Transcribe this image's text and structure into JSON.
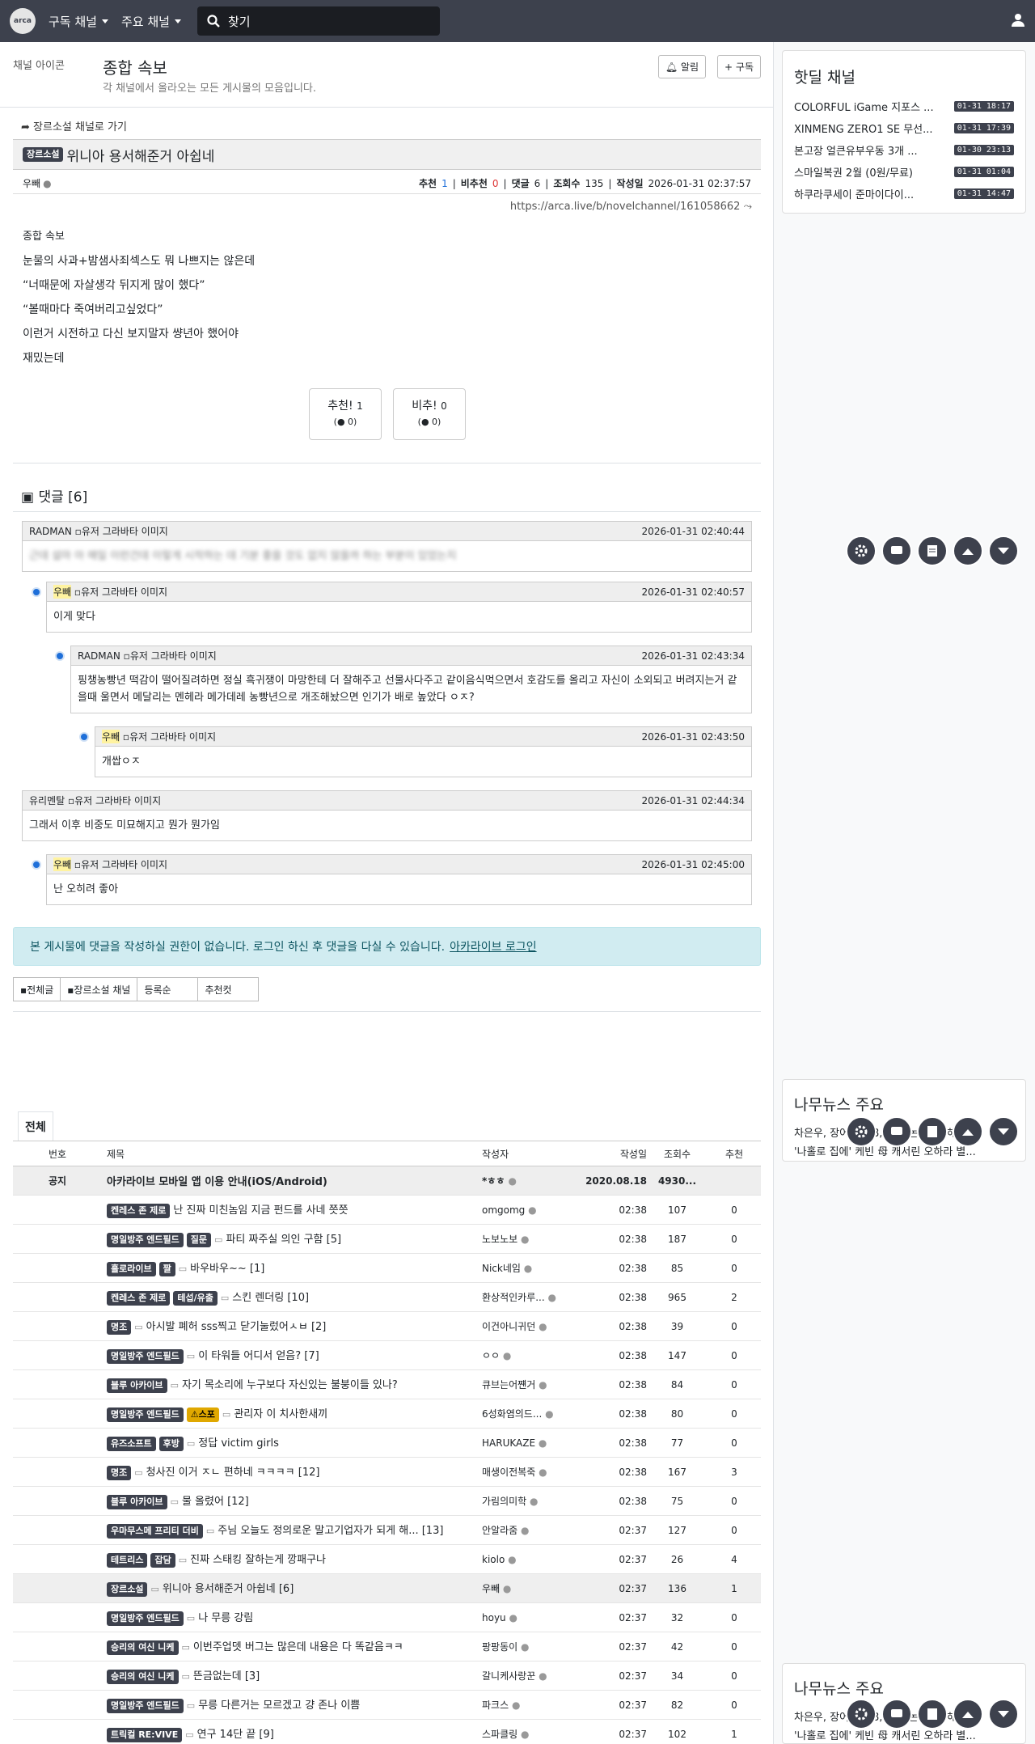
{
  "nav": {
    "logo": "arca",
    "subscribed": "구독 채널",
    "main_channels": "주요 채널",
    "search_placeholder": "찾기"
  },
  "channel": {
    "img_alt": "채널 아이콘",
    "title": "종합 속보",
    "desc": "각 채널에서 올라오는 모든 게시물의 모음입니다.",
    "alarm": "알림",
    "subscribe": "구독"
  },
  "post": {
    "goto": "장르소설 채널로 가기",
    "category": "장르소설",
    "title": "위니아 용서해준거 아쉽네",
    "author": "우빼",
    "stats": {
      "rec_label": "추천",
      "rec": "1",
      "nrec_label": "비추천",
      "nrec": "0",
      "cmt_label": "댓글",
      "cmt": "6",
      "views_label": "조회수",
      "views": "135",
      "date_label": "작성일",
      "date": "2026-01-31 02:37:57"
    },
    "url": "https://arca.live/b/novelchannel/161058662",
    "img_alt": "종합 속보",
    "lines": [
      "눈물의 사과+밤샘사죄섹스도 뭐 나쁘지는 않은데",
      "“너때문에 자살생각 뒤지게 많이 했다”",
      "“볼때마다 죽여버리고싶었다”",
      "이런거 시전하고 다신 보지말자 썅년아 했어야",
      "재밌는데"
    ],
    "vote_up": "추천!",
    "vote_up_count": "1",
    "vote_up_sub": "0",
    "vote_down": "비추!",
    "vote_down_count": "0",
    "vote_down_sub": "0"
  },
  "comments": {
    "header": "댓글 [6]",
    "avatar_alt": "유저 그라바타 이미지",
    "items": [
      {
        "author": "RADMAN",
        "time": "2026-01-31 02:40:44",
        "text": "근데 설마 아 매일 이런건데 이렇게 시작하는 데 기분 좋을 것도 없지 않을까 하는 부분이 있었는지"
      },
      {
        "author": "우빼",
        "time": "2026-01-31 02:40:57",
        "text": "이게 맞다"
      },
      {
        "author": "RADMAN",
        "time": "2026-01-31 02:43:34",
        "text": "핑챙농빵년 떡감이 떨어질려하면 정실 흑귀쟁이 마망한테 더 잘해주고 선물사다주고 같이음식먹으면서 호감도를 올리고 자신이 소외되고 버려지는거 같을때 울면서 메달리는 멘헤라 메가데레 농빵년으로 개조해놨으면 인기가 배로 높았다 ㅇㅈ?"
      },
      {
        "author": "우빼",
        "time": "2026-01-31 02:43:50",
        "text": "개쌉ㅇㅈ"
      },
      {
        "author": "유리멘탈",
        "time": "2026-01-31 02:44:34",
        "text": "그래서 이후 비중도 미묘해지고 뭔가 뭔가임"
      },
      {
        "author": "우빼",
        "time": "2026-01-31 02:45:00",
        "text": "난 오히려 좋아"
      }
    ]
  },
  "notice": {
    "text": "본 게시물에 댓글을 작성하실 권한이 없습니다. 로그인 하신 후 댓글을 다실 수 있습니다.",
    "link": "아카라이브 로그인"
  },
  "filters": [
    "전체글",
    "장르소설 채널",
    "등록순",
    "추천컷"
  ],
  "table": {
    "tab": "전체",
    "headers": [
      "번호",
      "제목",
      "작성자",
      "작성일",
      "조회수",
      "추천"
    ],
    "rows": [
      {
        "num": "공지",
        "badges": [],
        "title": "아카라이브 모바일 앱 이용 안내(iOS/Android)",
        "author": "*ㅎㅎ",
        "date": "2020.08.18",
        "views": "4930...",
        "rec": ""
      },
      {
        "num": "",
        "badges": [
          "켄레스 존 제로"
        ],
        "title": "난 진짜 미친놈임 지금 펀드를 사네 쯧쯧",
        "author": "omgomg",
        "date": "02:38",
        "views": "107",
        "rec": "0"
      },
      {
        "num": "",
        "badges": [
          "명일방주 엔드필드",
          "질문"
        ],
        "title": "파티 짜주실 의인 구함 [5]",
        "author": "노보노보",
        "date": "02:38",
        "views": "187",
        "rec": "0"
      },
      {
        "num": "",
        "badges": [
          "홀로라이브",
          "짤"
        ],
        "title": "바우바우~~ [1]",
        "author": "Nick네임",
        "date": "02:38",
        "views": "85",
        "rec": "0"
      },
      {
        "num": "",
        "badges": [
          "켄레스 존 제로",
          "테섭/유출"
        ],
        "title": "스킨 렌더링 [10]",
        "author": "환상적인카루...",
        "date": "02:38",
        "views": "965",
        "rec": "2"
      },
      {
        "num": "",
        "badges": [
          "명조"
        ],
        "title": "아시발 폐허 sss찍고 닫기눌렀어ㅅㅂ [2]",
        "author": "이건아니귀던",
        "date": "02:38",
        "views": "39",
        "rec": "0"
      },
      {
        "num": "",
        "badges": [
          "명일방주 엔드필드"
        ],
        "title": "이 타워들 어디서 얻음? [7]",
        "author": "ㅇㅇ",
        "date": "02:38",
        "views": "147",
        "rec": "0"
      },
      {
        "num": "",
        "badges": [
          "블루 아카이브"
        ],
        "title": "자기 목소리에 누구보다 자신있는 불붕이들 있나?",
        "author": "큐브는어쨴거",
        "date": "02:38",
        "views": "84",
        "rec": "0"
      },
      {
        "num": "",
        "badges": [
          "명일방주 엔드필드",
          "⚠스포"
        ],
        "title": "관리자 이 치사한새끼",
        "author": "6성화염의드...",
        "date": "02:38",
        "views": "80",
        "rec": "0"
      },
      {
        "num": "",
        "badges": [
          "유즈소프트",
          "후방"
        ],
        "title": "정답 victim girls",
        "author": "HARUKAZE",
        "date": "02:38",
        "views": "77",
        "rec": "0"
      },
      {
        "num": "",
        "badges": [
          "명조"
        ],
        "title": "청사진 이거 ㅈㄴ 편하네 ㅋㅋㅋㅋ [12]",
        "author": "매생이전복죽",
        "date": "02:38",
        "views": "167",
        "rec": "3"
      },
      {
        "num": "",
        "badges": [
          "블루 아카이브"
        ],
        "title": "물 올렸어 [12]",
        "author": "가림의미학",
        "date": "02:38",
        "views": "75",
        "rec": "0"
      },
      {
        "num": "",
        "badges": [
          "우마무스메 프리티 더비"
        ],
        "title": "주님 오늘도 정의로운 말고기업자가 되게 해... [13]",
        "author": "안알라줌",
        "date": "02:37",
        "views": "127",
        "rec": "0"
      },
      {
        "num": "",
        "badges": [
          "테트리스",
          "잡담"
        ],
        "title": "진짜 스태킹 잘하는게 깡패구나",
        "author": "kiolo",
        "date": "02:37",
        "views": "26",
        "rec": "4"
      },
      {
        "num": "",
        "badges": [
          "장르소설"
        ],
        "title": "위니아 용서해준거 아쉽네 [6]",
        "author": "우빼",
        "date": "02:37",
        "views": "136",
        "rec": "1"
      },
      {
        "num": "",
        "badges": [
          "명일방주 엔드필드"
        ],
        "title": "나 무릉 강림",
        "author": "hoyu",
        "date": "02:37",
        "views": "32",
        "rec": "0"
      },
      {
        "num": "",
        "badges": [
          "승리의 여신 니케"
        ],
        "title": "이번주업뎃 버그는 많은데 내용은 다 똑같음ㅋㅋ",
        "author": "팡팡동이",
        "date": "02:37",
        "views": "42",
        "rec": "0"
      },
      {
        "num": "",
        "badges": [
          "승리의 여신 니케"
        ],
        "title": "뜬금없는데 [3]",
        "author": "갈니케사랑꾼",
        "date": "02:37",
        "views": "34",
        "rec": "0"
      },
      {
        "num": "",
        "badges": [
          "명일방주 엔드필드"
        ],
        "title": "무릉 다른거는 모르겠고 걍 존나 이쁨",
        "author": "파크스",
        "date": "02:37",
        "views": "82",
        "rec": "0"
      },
      {
        "num": "",
        "badges": [
          "트릭컬 RE:VIVE"
        ],
        "title": "연구 14단 끝 [9]",
        "author": "스파클링",
        "date": "02:37",
        "views": "102",
        "rec": "1"
      }
    ]
  },
  "sidebar": {
    "hot_title": "핫딜 채널",
    "hot": [
      {
        "title": "COLORFUL iGame 지포스 ...",
        "date": "01-31 18:17"
      },
      {
        "title": "XINMENG ZERO1 SE 무선...",
        "date": "01-31 17:39"
      },
      {
        "title": "본고장 얼큰유부우동 3개 ...",
        "date": "01-30 23:13"
      },
      {
        "title": "스마일복권 2월 (0원/무료)",
        "date": "01-31 01:04"
      },
      {
        "title": "하쿠라쿠세이 준마이다이...",
        "date": "01-31 14:47"
      }
    ],
    "news_title": "나무뉴스 주요",
    "news": [
      "차은우, 장어 2008, 탈세 논란 뒤 '해명'...",
      "'나홀로 집에' 케빈 母 캐서린 오하라 별..."
    ]
  }
}
